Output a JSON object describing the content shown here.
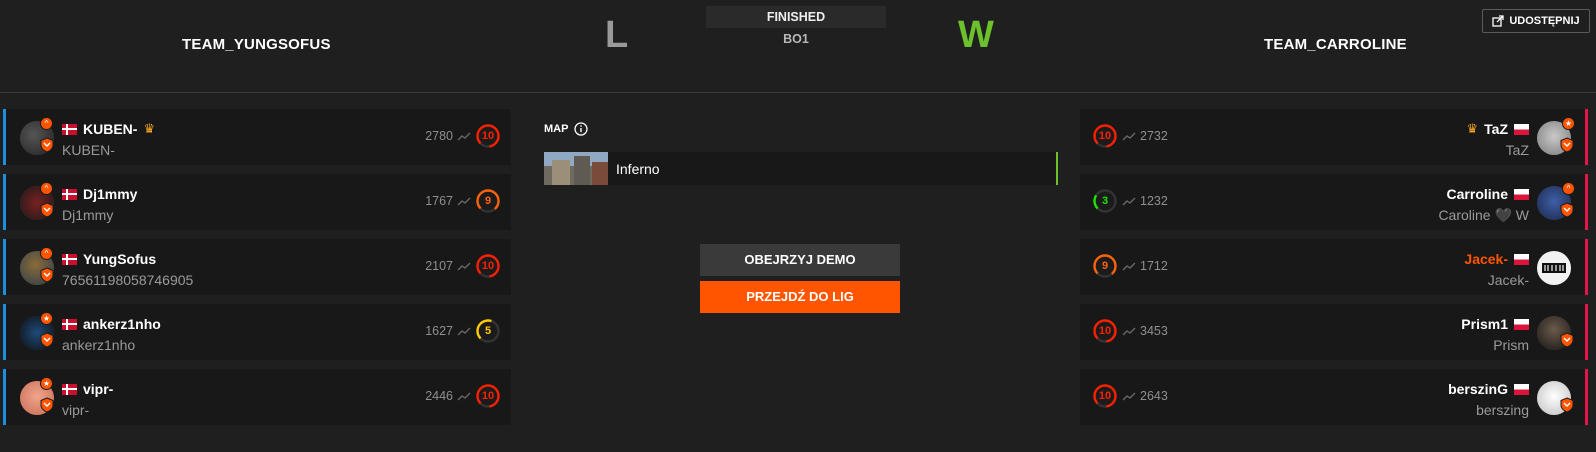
{
  "header": {
    "team_left": "TEAM_YUNGSOFUS",
    "team_right": "TEAM_CARROLINE",
    "result_left": "L",
    "result_right": "W",
    "status": "FINISHED",
    "format": "BO1",
    "share_label": "UDOSTĘPNIJ"
  },
  "map_section": {
    "title": "MAP",
    "map_name": "Inferno"
  },
  "buttons": {
    "watch_demo": "OBEJRZYJ DEMO",
    "go_to_leagues": "PRZEJDŹ DO LIG"
  },
  "colors": {
    "accent_orange": "#ff5500",
    "win_green": "#6cc22c",
    "left_team_border": "#1d8fe0",
    "right_team_border": "#e4154b"
  },
  "left_players": [
    {
      "nickname": "KUBEN-",
      "subname": "KUBEN-",
      "elo": "2780",
      "level": "10",
      "flag": "dk",
      "captain": true
    },
    {
      "nickname": "Dj1mmy",
      "subname": "Dj1mmy",
      "elo": "1767",
      "level": "9",
      "flag": "dk",
      "captain": false
    },
    {
      "nickname": "YungSofus",
      "subname": "76561198058746905",
      "elo": "2107",
      "level": "10",
      "flag": "dk",
      "captain": false
    },
    {
      "nickname": "ankerz1nho",
      "subname": "ankerz1nho",
      "elo": "1627",
      "level": "5",
      "flag": "dk",
      "captain": false
    },
    {
      "nickname": "vipr-",
      "subname": "vipr-",
      "elo": "2446",
      "level": "10",
      "flag": "dk",
      "captain": false
    }
  ],
  "right_players": [
    {
      "nickname": "TaZ",
      "subname": "TaZ",
      "elo": "2732",
      "level": "10",
      "flag": "pl",
      "captain": true
    },
    {
      "nickname": "Carroline",
      "subname": "Caroline 🖤 W",
      "elo": "1232",
      "level": "3",
      "flag": "pl",
      "captain": false
    },
    {
      "nickname": "Jacek-",
      "subname": "Jacek-",
      "elo": "1712",
      "level": "9",
      "flag": "pl",
      "captain": false
    },
    {
      "nickname": "Prism1",
      "subname": "Prism",
      "elo": "3453",
      "level": "10",
      "flag": "pl",
      "captain": false
    },
    {
      "nickname": "berszinG",
      "subname": "berszing",
      "elo": "2643",
      "level": "10",
      "flag": "pl",
      "captain": false
    }
  ]
}
